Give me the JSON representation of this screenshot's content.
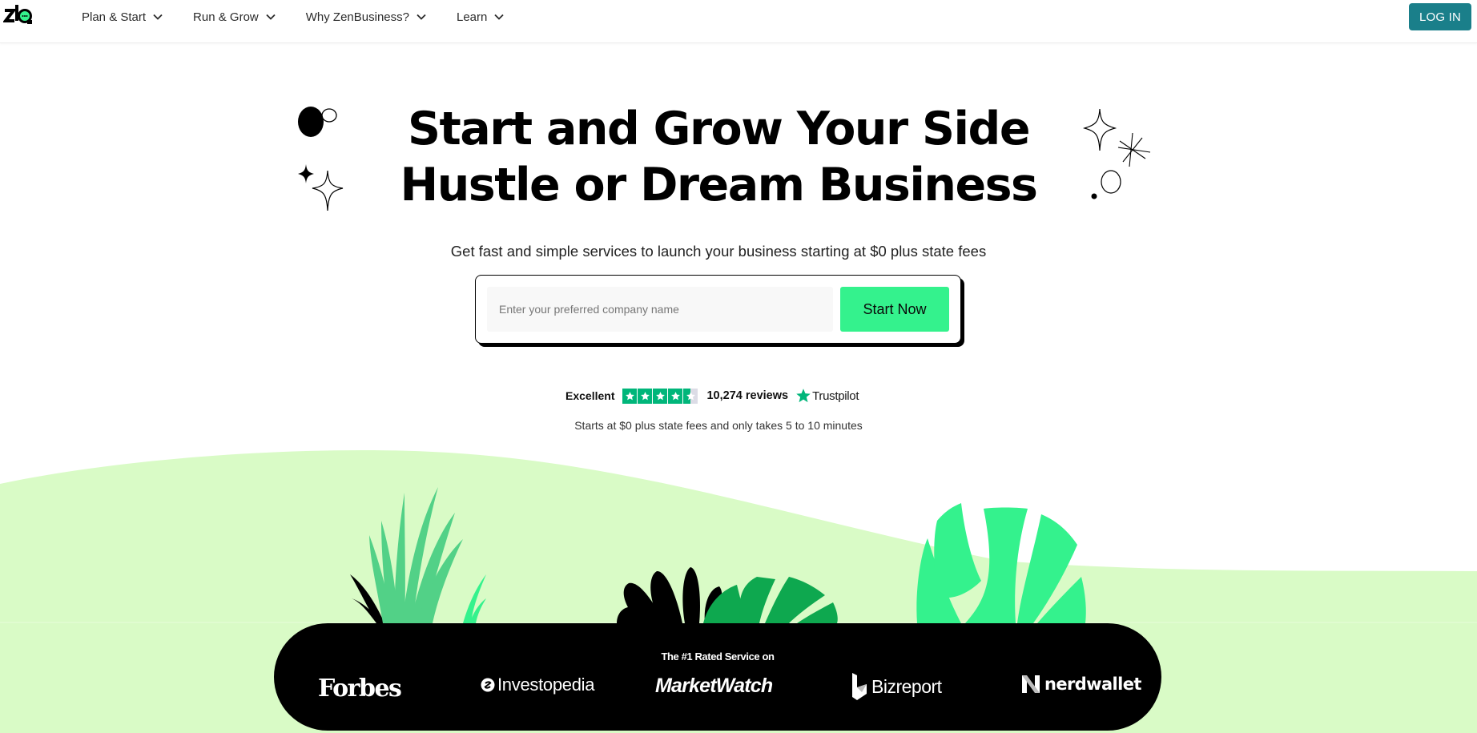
{
  "header": {
    "logo_alt": "zb",
    "nav": [
      {
        "label": "Plan & Start",
        "icon": "chevron-down-icon"
      },
      {
        "label": "Run & Grow",
        "icon": "chevron-down-icon"
      },
      {
        "label": "Why ZenBusiness?",
        "icon": "chevron-down-icon"
      },
      {
        "label": "Learn",
        "icon": "chevron-down-icon"
      }
    ],
    "login_label": "LOG IN"
  },
  "hero": {
    "headline_line1": "Start and Grow Your Side",
    "headline_line2": "Hustle or Dream Business",
    "subtitle": "Get fast and simple services to launch your business starting at $0 plus state fees",
    "search": {
      "value": "",
      "placeholder": "Enter your preferred company name",
      "button_label": "Start Now"
    }
  },
  "trustpilot": {
    "label": "Excellent",
    "rating": 4.5,
    "max_rating": 5,
    "review_count": "10,274 reviews",
    "brand": "Trustpilot"
  },
  "trust_subtext": "Starts at $0 plus state fees and only takes 5 to 10 minutes",
  "press": {
    "title": "The #1 Rated Service on",
    "logos": [
      "Forbes",
      "Investopedia",
      "MarketWatch",
      "Bizreport",
      "nerdwallet"
    ]
  },
  "colors": {
    "brand_green": "#34f28d",
    "login_teal": "#1a7f8a",
    "trustpilot_green": "#00b67a",
    "hill_green": "#d9fbc6",
    "grass_green": "#52d187",
    "leaf_dark_green": "#0ea84f"
  }
}
